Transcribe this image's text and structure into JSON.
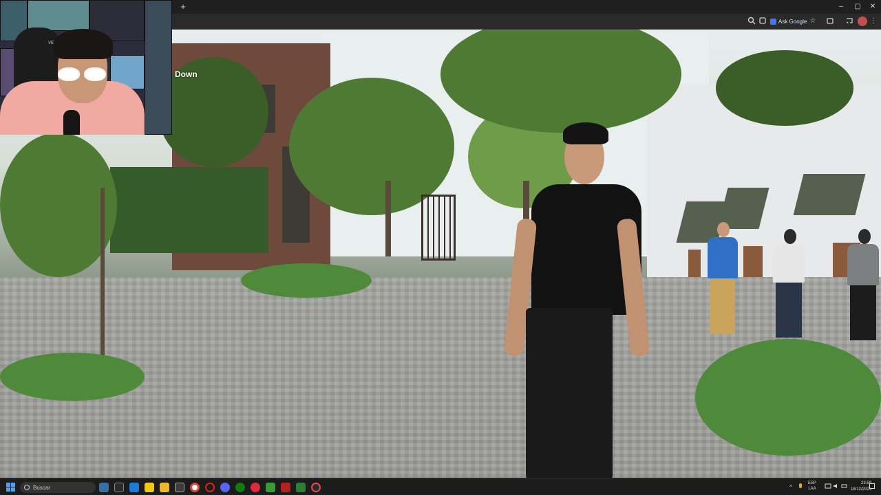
{
  "browser": {
    "new_tab_label": "+",
    "window_controls": {
      "minimize": "–",
      "maximize": "▢",
      "close": "✕"
    },
    "toolbar": {
      "zoom_icon": "magnifier",
      "refresh_icon": "reload",
      "ask_google_label": "Ask Google",
      "bookmark_icon": "☆",
      "extensions_icon": "puzzle",
      "cast_icon": "cast",
      "menu_icon": "⋮"
    }
  },
  "video": {
    "title_fragment": "Down"
  },
  "webcam": {
    "chair_brand": "VER"
  },
  "taskbar": {
    "search_placeholder": "Buscar",
    "language_line1": "ESP",
    "language_line2": "LAA",
    "time": "23:58",
    "date": "18/12/2025",
    "accent_color": "#4aa3f0"
  }
}
